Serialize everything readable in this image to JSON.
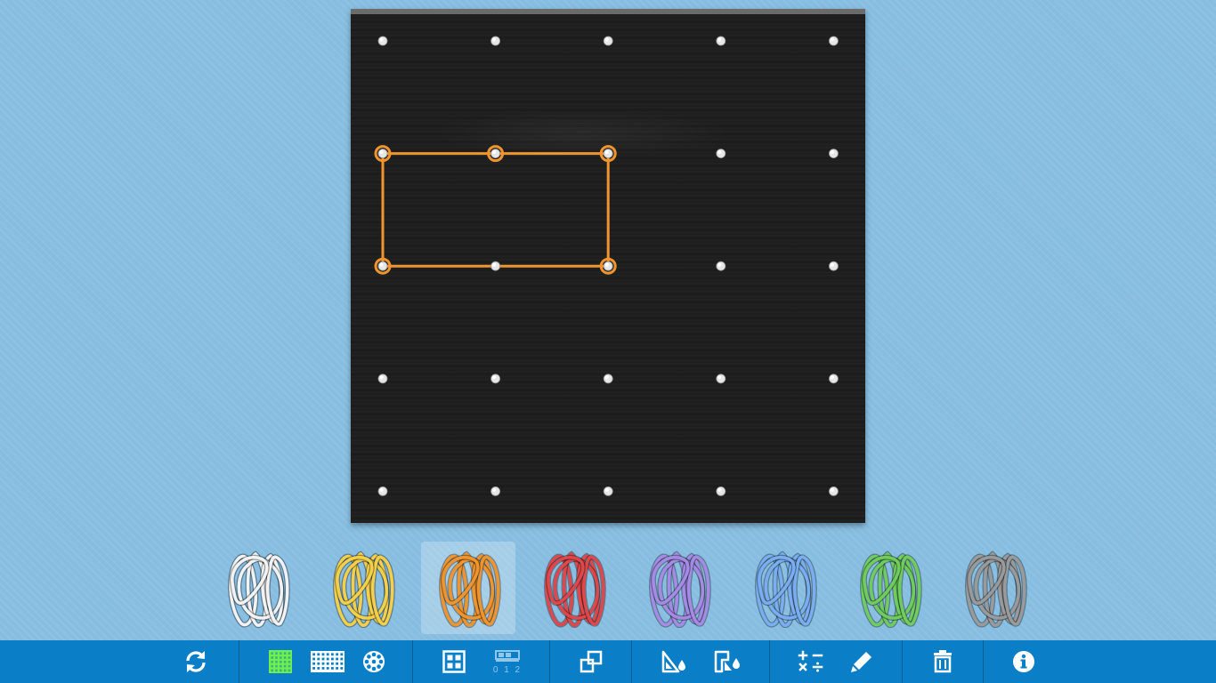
{
  "board": {
    "grid": "5x5",
    "active_band": {
      "color": "#f0952e",
      "pegs": [
        [
          0,
          1
        ],
        [
          1,
          1
        ],
        [
          2,
          1
        ],
        [
          2,
          2
        ],
        [
          1,
          2
        ],
        [
          0,
          2
        ]
      ]
    }
  },
  "band_palette": [
    {
      "name": "white-band",
      "color": "#f2f2f2",
      "selected": false
    },
    {
      "name": "yellow-band",
      "color": "#f4d04a",
      "selected": false
    },
    {
      "name": "orange-band",
      "color": "#f0952e",
      "selected": true
    },
    {
      "name": "red-band",
      "color": "#e0474a",
      "selected": false
    },
    {
      "name": "purple-band",
      "color": "#a58be6",
      "selected": false
    },
    {
      "name": "blue-band",
      "color": "#79aef2",
      "selected": false
    },
    {
      "name": "green-band",
      "color": "#6fcd5d",
      "selected": false
    },
    {
      "name": "gray-band",
      "color": "#9a9a9a",
      "selected": false
    }
  ],
  "toolbar": {
    "active_color": "#6ff04a",
    "number_line_label": "0 1 2",
    "icons": [
      "refresh-icon",
      "grid-5x5-icon",
      "grid-rect-icon",
      "circle-board-icon",
      "square-unit-icon",
      "number-line-icon",
      "duplicate-icon",
      "measure-angle-icon",
      "fill-color-icon",
      "calculate-icon",
      "pen-icon",
      "trash-icon",
      "info-icon"
    ]
  }
}
